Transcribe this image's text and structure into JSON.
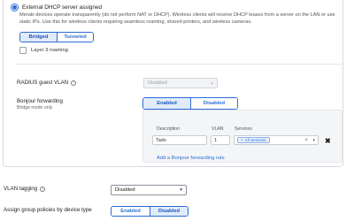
{
  "dhcp": {
    "option_label": "External DHCP server assigned",
    "description": "Meraki devices operate transparently (do not perform NAT or DHCP). Wireless clients will receive DHCP leases from a server on the LAN or use static IPs. Use this for wireless clients requiring seamless roaming, shared printers, and wireless cameras.",
    "mode_options": [
      "Bridged",
      "Tunneled"
    ],
    "mode_selected": "Bridged",
    "layer3_roaming_label": "Layer 3 roaming",
    "layer3_roaming_checked": false
  },
  "radius_guest_vlan": {
    "label": "RADIUS guest VLAN",
    "value": "Disabled",
    "disabled": true
  },
  "bonjour": {
    "label": "Bonjour forwarding",
    "sublabel": "Bridge mode only",
    "options": [
      "Enabled",
      "Disabled"
    ],
    "selected": "Enabled",
    "table": {
      "headers": [
        "Description",
        "VLAN",
        "Services"
      ],
      "rows": [
        {
          "description": "Tado",
          "vlan": "1",
          "services": [
            "All Services"
          ]
        }
      ]
    },
    "add_rule_label": "Add a Bonjour forwarding rule"
  },
  "vlan_tagging": {
    "label": "VLAN tagging",
    "value": "Disabled"
  },
  "group_policies": {
    "label": "Assign group policies by device type",
    "options": [
      "Enabled",
      "Disabled"
    ],
    "selected": "Disabled"
  },
  "colors": {
    "accent": "#2b6cd6",
    "active_segment_bg": "#e1ebfb",
    "rules_box_bg": "#f4f5f7"
  },
  "icons": {
    "info": "info-icon",
    "caret": "chevron-down-icon",
    "remove": "close-icon"
  }
}
